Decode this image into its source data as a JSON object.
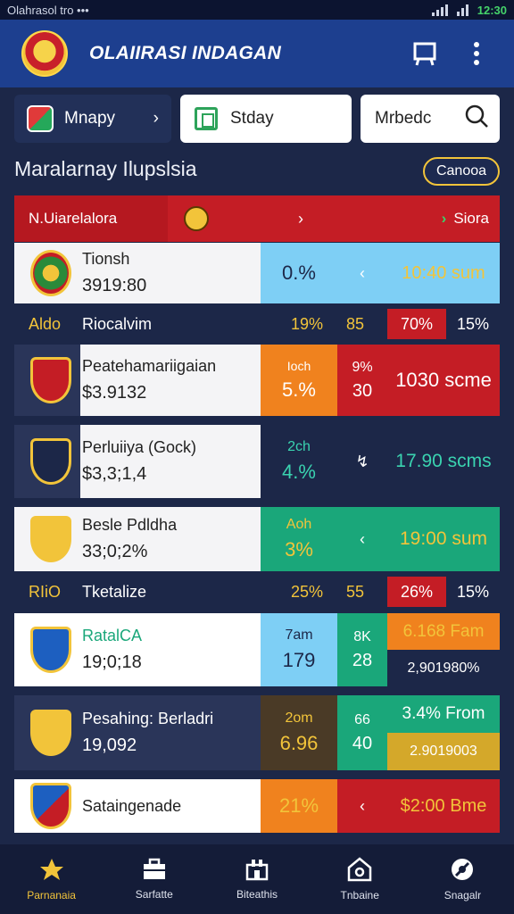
{
  "status_bar": {
    "left_text": "Olahrasol tro",
    "dots": "•••",
    "time": "12:30"
  },
  "app_bar": {
    "title": "OLAIIRASI INDAGAN"
  },
  "filters": {
    "nav_label": "Mnapy",
    "nav_chevron": "›",
    "day_label": "Stday",
    "search_placeholder": "Mrbedc"
  },
  "section": {
    "title": "Maralarnay Ilupslsia",
    "pill": "Canooa"
  },
  "header_row": {
    "left": "N.Uiarelalora",
    "arrow": "›",
    "right_arrow": "›",
    "right": "Siora"
  },
  "cards": [
    {
      "name": "Tionsh",
      "value": "3919:80",
      "pct": "0.%",
      "arrow": "‹",
      "time": "10:40 sum"
    },
    {
      "name": "Peatehamariigaian",
      "value": "$3.9132",
      "top": "Ioch",
      "pct": "5.%",
      "mid_top": "9%",
      "mid_num": "30",
      "time": "1030 scme"
    },
    {
      "name": "Perluiiya (Gock)",
      "value": "$3,3;1,4",
      "top": "2ch",
      "pct": "4.%",
      "arrow": "↯",
      "time": "17.90 scms"
    },
    {
      "name": "Besle Pdldha",
      "value": "33;0;2%",
      "top": "Aoh",
      "pct": "3%",
      "arrow": "‹",
      "time": "19:00 sum"
    },
    {
      "name": "RatalCA",
      "value": "19;0;18",
      "top": "7am",
      "pct": "179",
      "mid_top": "8K",
      "mid_num": "28",
      "time": "6.168 Fam",
      "sub": "2,901980%"
    },
    {
      "name": "Pesahing: Berladri",
      "value": "19,092",
      "top": "2om",
      "pct": "6.96",
      "mid_top": "66",
      "mid_num": "40",
      "time": "3.4% From",
      "sub": "2.9019003"
    },
    {
      "name": "Sataingenade",
      "pct": "21%",
      "arrow": "‹",
      "time": "$2:00 Bme"
    }
  ],
  "stats_rows": [
    {
      "code": "Aldo",
      "label": "Riocalvim",
      "pct": "19%",
      "num": "85",
      "badge": "70%",
      "last": "15%"
    },
    {
      "code": "RIiO",
      "label": "Tketalize",
      "pct": "25%",
      "num": "55",
      "badge": "26%",
      "last": "15%"
    }
  ],
  "tabs": [
    {
      "label": "Parnanaia"
    },
    {
      "label": "Sarfatte"
    },
    {
      "label": "Biteathis"
    },
    {
      "label": "Tnbaine"
    },
    {
      "label": "Snagalr"
    }
  ],
  "colors": {
    "bg": "#1c2748",
    "appbar": "#1d3f8f",
    "red": "#c41d25",
    "gold": "#f2c43a",
    "green": "#1aa77a",
    "sky": "#7ecff5",
    "orange": "#f0821e"
  }
}
